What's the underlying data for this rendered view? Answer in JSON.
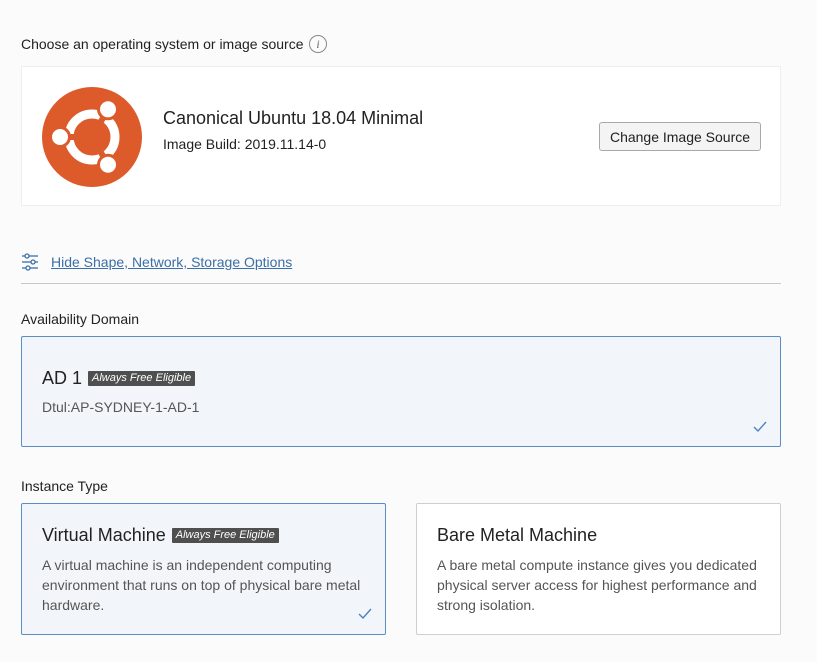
{
  "image_source": {
    "label": "Choose an operating system or image source",
    "info_icon": "info-icon",
    "logo": "ubuntu-logo",
    "title": "Canonical Ubuntu 18.04 Minimal",
    "build": "Image Build: 2019.11.14-0",
    "change_button": "Change Image Source",
    "brand_color": "#dd5a2b"
  },
  "options": {
    "icon": "sliders-icon",
    "link_label": "Hide Shape, Network, Storage Options",
    "link_color": "#3a6fa8"
  },
  "availability_domain": {
    "label": "Availability Domain",
    "selected": {
      "title": "AD 1",
      "badge": "Always Free Eligible",
      "subtitle": "Dtul:AP-SYDNEY-1-AD-1",
      "selected_state": true
    }
  },
  "instance_type": {
    "label": "Instance Type",
    "options": [
      {
        "title": "Virtual Machine",
        "badge": "Always Free Eligible",
        "description": "A virtual machine is an independent computing environment that runs on top of physical bare metal hardware.",
        "selected_state": true
      },
      {
        "title": "Bare Metal Machine",
        "description": "A bare metal compute instance gives you dedicated physical server access for highest performance and strong isolation.",
        "selected_state": false
      }
    ]
  },
  "colors": {
    "selected_border": "#5a8fc6",
    "selected_background": "#f2f6fa",
    "badge_background": "#4f4f4f"
  }
}
